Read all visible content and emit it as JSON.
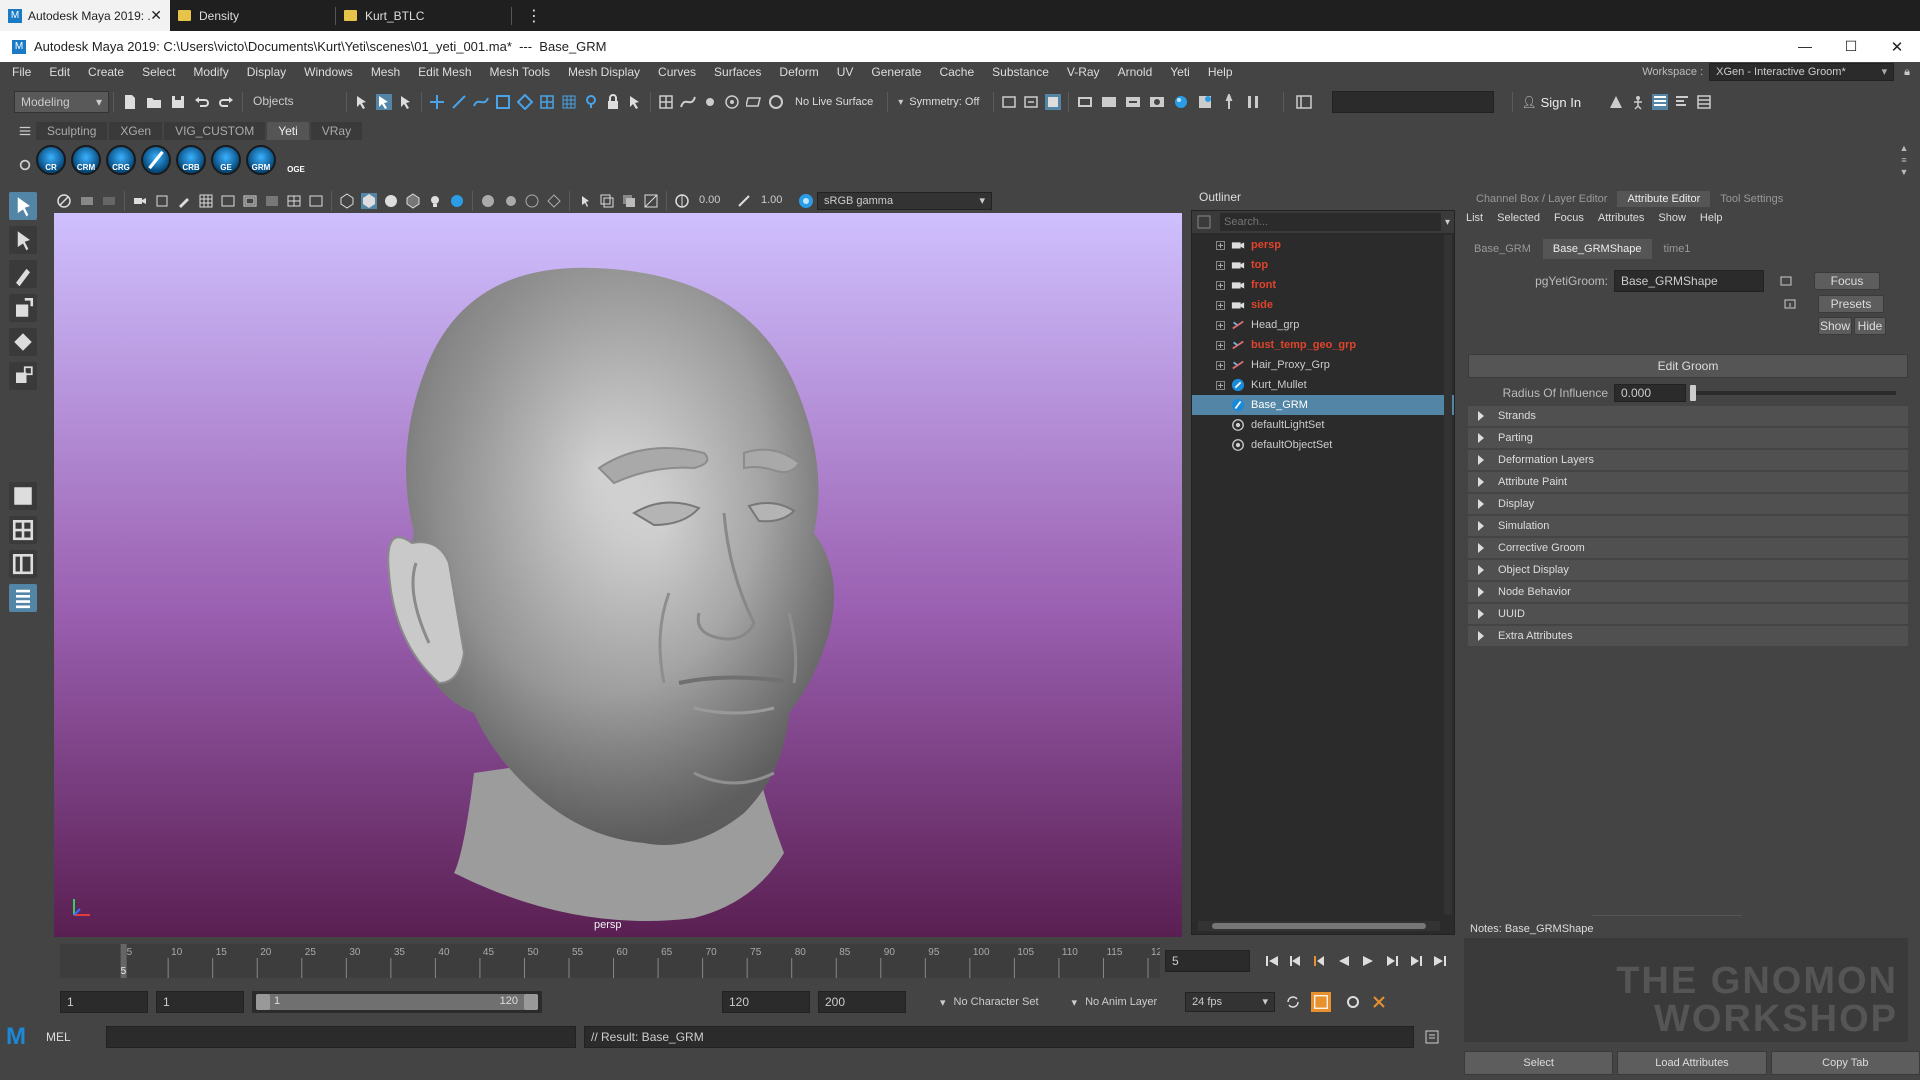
{
  "browser_tabs": [
    {
      "label": "Autodesk Maya 2019: ...",
      "active": true
    },
    {
      "label": "Density",
      "active": false
    },
    {
      "label": "Kurt_BTLC",
      "active": false
    }
  ],
  "window": {
    "title": "Autodesk Maya 2019: C:\\Users\\victo\\Documents\\Kurt\\Yeti\\scenes\\01_yeti_001.ma*  ---  Base_GRM"
  },
  "menu": [
    "File",
    "Edit",
    "Create",
    "Select",
    "Modify",
    "Display",
    "Windows",
    "Mesh",
    "Edit Mesh",
    "Mesh Tools",
    "Mesh Display",
    "Curves",
    "Surfaces",
    "Deform",
    "UV",
    "Generate",
    "Cache",
    "Substance",
    "V-Ray",
    "Arnold",
    "Yeti",
    "Help"
  ],
  "workspace": {
    "label": "Workspace :",
    "value": "XGen - Interactive Groom*"
  },
  "status": {
    "mode": "Modeling",
    "objects": "Objects",
    "live_surface": "No Live Surface",
    "symmetry": "Symmetry: Off",
    "sign_in": "Sign In"
  },
  "shelf_tabs": [
    {
      "label": "Sculpting",
      "active": false
    },
    {
      "label": "XGen",
      "active": false
    },
    {
      "label": "VIG_CUSTOM",
      "active": false
    },
    {
      "label": "Yeti",
      "active": true
    },
    {
      "label": "VRay",
      "active": false
    }
  ],
  "shelf_buttons": [
    "CR",
    "CRM",
    "CRG",
    "",
    "CRB",
    "GE",
    "GRM",
    "OGE"
  ],
  "viewport": {
    "camera": "persp",
    "exposure": "0.00",
    "gamma": "1.00",
    "color_space": "sRGB gamma"
  },
  "timeline": {
    "ticks": [
      "5",
      "10",
      "15",
      "20",
      "25",
      "30",
      "35",
      "40",
      "45",
      "50",
      "55",
      "60",
      "65",
      "70",
      "75",
      "80",
      "85",
      "90",
      "95",
      "100",
      "105",
      "110",
      "115",
      "12"
    ],
    "current": "5",
    "current_field": "5"
  },
  "range": {
    "start": "1",
    "start2": "1",
    "range_start": "1",
    "range_end": "120",
    "end": "120",
    "end2": "200",
    "char_set": "No Character Set",
    "anim_layer": "No Anim Layer",
    "fps": "24 fps"
  },
  "cmd": {
    "lang": "MEL",
    "result": "// Result: Base_GRM"
  },
  "outliner": {
    "title": "Outliner",
    "search_placeholder": "Search...",
    "items": [
      {
        "label": "persp",
        "kind": "camera",
        "red": true,
        "selected": false,
        "expand": true
      },
      {
        "label": "top",
        "kind": "camera",
        "red": true,
        "selected": false,
        "expand": true
      },
      {
        "label": "front",
        "kind": "camera",
        "red": true,
        "selected": false,
        "expand": true
      },
      {
        "label": "side",
        "kind": "camera",
        "red": true,
        "selected": false,
        "expand": true
      },
      {
        "label": "Head_grp",
        "kind": "group",
        "red": false,
        "selected": false,
        "expand": true
      },
      {
        "label": "bust_temp_geo_grp",
        "kind": "group",
        "red": true,
        "selected": false,
        "expand": true
      },
      {
        "label": "Hair_Proxy_Grp",
        "kind": "group",
        "red": false,
        "selected": false,
        "expand": true
      },
      {
        "label": "Kurt_Mullet",
        "kind": "yeti",
        "red": false,
        "selected": false,
        "expand": true
      },
      {
        "label": "Base_GRM",
        "kind": "groom",
        "red": false,
        "selected": true,
        "expand": false
      },
      {
        "label": "defaultLightSet",
        "kind": "set",
        "red": false,
        "selected": false,
        "expand": false
      },
      {
        "label": "defaultObjectSet",
        "kind": "set",
        "red": false,
        "selected": false,
        "expand": false
      }
    ]
  },
  "ae": {
    "top_tabs": [
      {
        "label": "Channel Box / Layer Editor",
        "active": false
      },
      {
        "label": "Attribute Editor",
        "active": true
      },
      {
        "label": "Tool Settings",
        "active": false
      }
    ],
    "menu": [
      "List",
      "Selected",
      "Focus",
      "Attributes",
      "Show",
      "Help"
    ],
    "node_tabs": [
      {
        "label": "Base_GRM",
        "active": false
      },
      {
        "label": "Base_GRMShape",
        "active": true
      },
      {
        "label": "time1",
        "active": false
      }
    ],
    "node_label": "pgYetiGroom:",
    "node_value": "Base_GRMShape",
    "focus": "Focus",
    "presets": "Presets",
    "show": "Show",
    "hide": "Hide",
    "edit_groom": "Edit Groom",
    "radius_label": "Radius Of Influence",
    "radius_value": "0.000",
    "radius_fraction": 0.0,
    "sections": [
      "Strands",
      "Parting",
      "Deformation Layers",
      "Attribute Paint",
      "Display",
      "Simulation",
      "Corrective Groom",
      "Object Display",
      "Node Behavior",
      "UUID",
      "Extra Attributes"
    ],
    "notes": "Notes:  Base_GRMShape",
    "bottom": [
      "Select",
      "Load Attributes",
      "Copy Tab"
    ],
    "watermark": "THE GNOMON WORKSHOP"
  },
  "colors": {
    "selection": "#5285a6",
    "maya_blue": "#1a8ad8",
    "red_item": "#e0442c",
    "vp_top": "#cfc0ff",
    "vp_bottom": "#5a1f52"
  }
}
